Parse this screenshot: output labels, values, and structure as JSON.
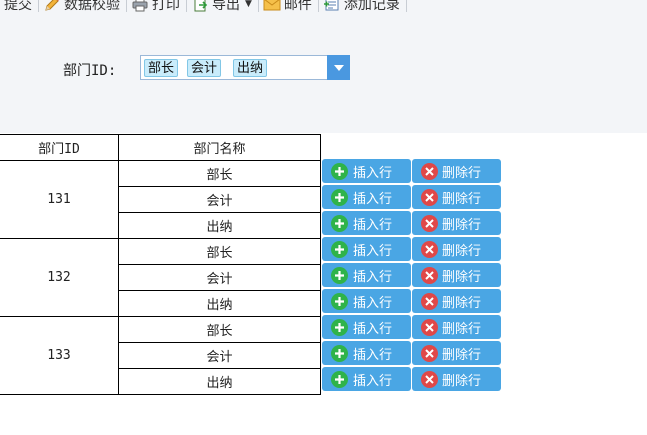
{
  "toolbar": {
    "items": [
      {
        "label": "提交",
        "icon": "submit-icon"
      },
      {
        "label": "数据校验",
        "icon": "pencil-icon"
      },
      {
        "label": "打印",
        "icon": "printer-icon"
      },
      {
        "label": "导出",
        "icon": "export-icon",
        "has_dropdown": true
      },
      {
        "label": "邮件",
        "icon": "mail-icon"
      },
      {
        "label": "添加记录",
        "icon": "add-record-icon"
      }
    ]
  },
  "param": {
    "label": "部门ID:",
    "selected_tags": [
      "部长",
      "会计",
      "出纳"
    ]
  },
  "table": {
    "headers": [
      "部门ID",
      "部门名称"
    ],
    "groups": [
      {
        "id": "131",
        "names": [
          "部长",
          "会计",
          "出纳"
        ]
      },
      {
        "id": "132",
        "names": [
          "部长",
          "会计",
          "出纳"
        ]
      },
      {
        "id": "133",
        "names": [
          "部长",
          "会计",
          "出纳"
        ]
      }
    ]
  },
  "row_actions": {
    "insert_label": "插入行",
    "delete_label": "删除行"
  },
  "colors": {
    "button_bg": "#4aa6e4",
    "plus_green": "#2fb34a",
    "delete_red": "#e04848",
    "panel_bg": "#f3f5f8",
    "tag_bg": "#c9ecfb"
  }
}
